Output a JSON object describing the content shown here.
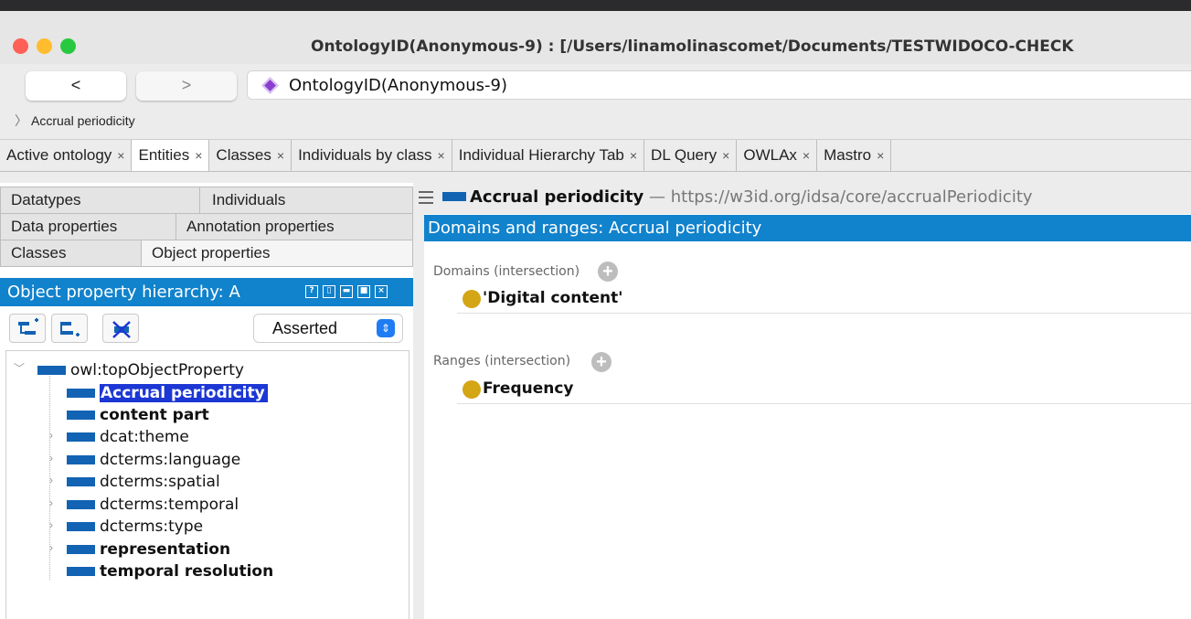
{
  "window": {
    "title": "OntologyID(Anonymous-9) : [/Users/linamolinascomet/Documents/TESTWIDOCO-CHECK",
    "colors": {
      "close": "#fe5f57",
      "minimize": "#febc2e",
      "zoom": "#28c840"
    }
  },
  "toolbar": {
    "back_label": "<",
    "forward_label": ">",
    "ontology_icon": "ontology-diamond-icon",
    "ontology_name": "OntologyID(Anonymous-9)",
    "breadcrumb": "Accrual periodicity"
  },
  "tabs": [
    {
      "label": "Active ontology",
      "close": "×"
    },
    {
      "label": "Entities",
      "close": "×"
    },
    {
      "label": "Classes",
      "close": "×"
    },
    {
      "label": "Individuals by class",
      "close": "×"
    },
    {
      "label": "Individual Hierarchy Tab",
      "close": "×"
    },
    {
      "label": "DL Query",
      "close": "×"
    },
    {
      "label": "OWLAx",
      "close": "×"
    },
    {
      "label": "Mastro",
      "close": "×"
    }
  ],
  "entity_tabs": {
    "datatypes": "Datatypes",
    "individuals": "Individuals",
    "data_properties": "Data properties",
    "annotation_properties": "Annotation properties",
    "classes": "Classes",
    "object_properties": "Object properties"
  },
  "hierarchy": {
    "title": "Object property hierarchy: A",
    "view_mode": "Asserted",
    "root": "owl:topObjectProperty",
    "items": [
      {
        "label": "Accrual periodicity",
        "bold": true,
        "selected": true,
        "expandable": false
      },
      {
        "label": "content part",
        "bold": true,
        "selected": false,
        "expandable": false
      },
      {
        "label": "dcat:theme",
        "bold": false,
        "selected": false,
        "expandable": true
      },
      {
        "label": "dcterms:language",
        "bold": false,
        "selected": false,
        "expandable": true
      },
      {
        "label": "dcterms:spatial",
        "bold": false,
        "selected": false,
        "expandable": true
      },
      {
        "label": "dcterms:temporal",
        "bold": false,
        "selected": false,
        "expandable": true
      },
      {
        "label": "dcterms:type",
        "bold": false,
        "selected": false,
        "expandable": true
      },
      {
        "label": "representation",
        "bold": true,
        "selected": false,
        "expandable": true
      },
      {
        "label": "temporal resolution",
        "bold": true,
        "selected": false,
        "expandable": false
      }
    ],
    "colors": {
      "header": "#1182cc",
      "selection": "#1c37d4",
      "property": "#1263b3"
    }
  },
  "details": {
    "entity_name": "Accrual periodicity",
    "entity_iri": "— https://w3id.org/idsa/core/accrualPeriodicity",
    "section_title": "Domains and ranges: Accrual periodicity",
    "domains_label": "Domains (intersection)",
    "domains": [
      "'Digital content'"
    ],
    "ranges_label": "Ranges (intersection)",
    "ranges": [
      "Frequency"
    ],
    "class_color": "#d4a514"
  }
}
